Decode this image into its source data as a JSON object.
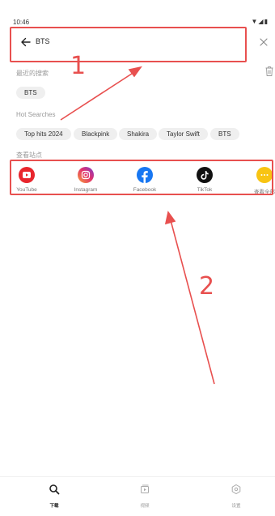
{
  "status_bar": {
    "time": "10:46",
    "icons": "▼◢▮"
  },
  "search": {
    "query": "BTS"
  },
  "recent": {
    "label": "最近的搜索",
    "items": [
      "BTS"
    ]
  },
  "hot": {
    "label": "Hot Searches",
    "items": [
      "Top hits 2024",
      "Blackpink",
      "Shakira",
      "Taylor Swift",
      "BTS"
    ]
  },
  "sites": {
    "label": "查看站点",
    "items": [
      {
        "label": "YouTube",
        "icon": "youtube-icon"
      },
      {
        "label": "Instagram",
        "icon": "instagram-icon"
      },
      {
        "label": "Facebook",
        "icon": "facebook-icon"
      },
      {
        "label": "TikTok",
        "icon": "tiktok-icon"
      },
      {
        "label": "查看全部",
        "icon": "more-icon"
      }
    ]
  },
  "annotations": {
    "one": "1",
    "two": "2",
    "color": "#e8504f"
  },
  "bottom_nav": {
    "items": [
      {
        "label": "下载",
        "active": true
      },
      {
        "label": "视频",
        "active": false
      },
      {
        "label": "设置",
        "active": false
      }
    ]
  }
}
